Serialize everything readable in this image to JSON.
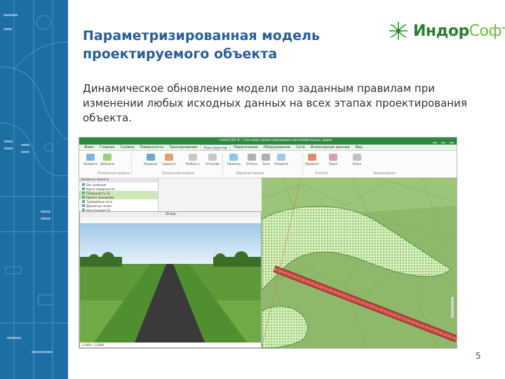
{
  "slide": {
    "title_line1": "Параметризированная модель",
    "title_line2": "проектируемого объекта",
    "description": "Динамическое обновление модели по заданным правилам при изменении любых исходных данных на всех этапах проектирования объекта.",
    "page_number": "5"
  },
  "logo": {
    "name_bold": "Индор",
    "name_light": "Софт",
    "color_dark": "#2e7d32",
    "color_light": "#6cbf3a"
  },
  "colors": {
    "left_band": "#1e6ea6",
    "title": "#2a5f95",
    "app_titlebar": "#2a8a3e"
  },
  "screenshot": {
    "window_title": "IndorCAD 9 – Система проектирования автомобильных дорог",
    "menu": [
      "Файл",
      "Главная",
      "Съёмка",
      "Поверхность",
      "Трассирование",
      "Конструктор",
      "Пересечения",
      "Оборудование",
      "Сети",
      "Инженерные данные",
      "Вид"
    ],
    "active_menu": "Конструктор",
    "ribbon_groups": [
      "Поперечный профиль",
      "Продольный профиль",
      "Дорожная одежда",
      "Отметки",
      "Выравнивание"
    ],
    "ribbon_buttons": [
      "Поперечный профиль",
      "Шаблоны",
      "Продольный профиль",
      "Сдвинуть элемент",
      "Разбить элемент",
      "Установить отметки",
      "Табличный редактор",
      "Откосы",
      "Зона",
      "Поперечник",
      "Применить правила",
      "Поиск",
      "Уклон"
    ],
    "tree_header": "Элементы проекта",
    "tree_items": [
      "Без названия",
      "Карта поверхности",
      "Поверхность (1)",
      "Проект (основной)",
      "Трамвайные пути",
      "Дорожные знаки",
      "Конструкция (1)",
      "Выемка–насыпь (2)"
    ],
    "view3d_title": "3D-вид",
    "view3d_status": "1:2000 | 1:2000"
  }
}
